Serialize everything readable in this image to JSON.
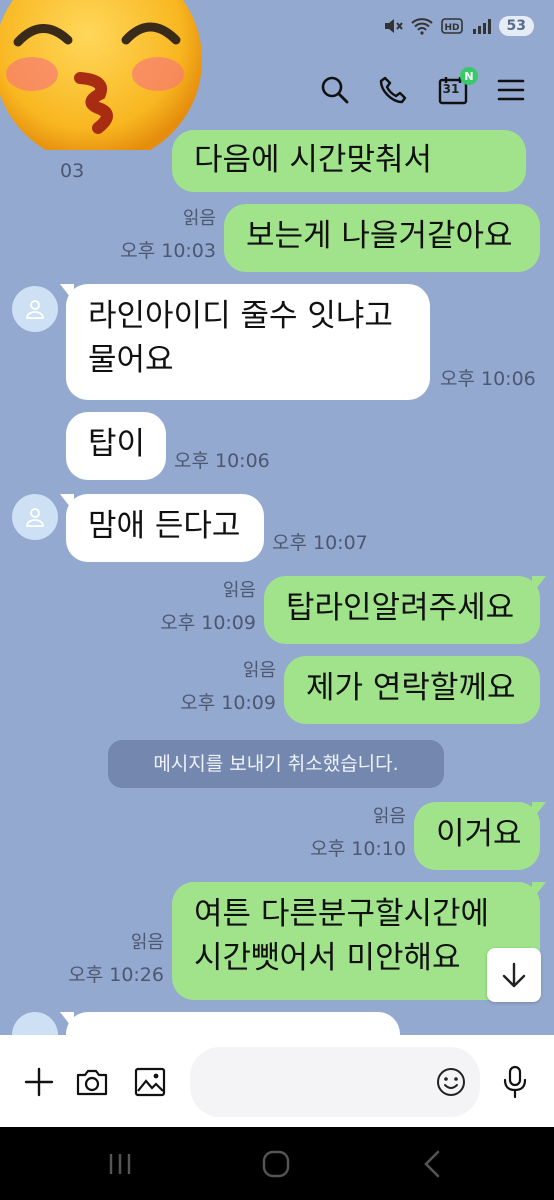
{
  "status_bar": {
    "battery": "53"
  },
  "top_bar": {
    "calendar_day": "31",
    "calendar_badge": "N"
  },
  "messages": [
    {
      "text": "다음에 시간맞춰서",
      "time": "03"
    },
    {
      "read": "읽음",
      "time": "오후 10:03",
      "text": "보는게 나을거같아요"
    },
    {
      "line1": "라인아이디 줄수 잇냐고",
      "line2": "물어요",
      "time": "오후 10:06"
    },
    {
      "text": "탑이",
      "time": "오후 10:06"
    },
    {
      "text": "맘애 든다고",
      "time": "오후 10:07"
    },
    {
      "read": "읽음",
      "time": "오후 10:09",
      "text": "탑라인알려주세요"
    },
    {
      "read": "읽음",
      "time": "오후 10:09",
      "text": "제가 연락할께요"
    },
    {
      "read": "읽음",
      "time": "오후 10:10",
      "text": "이거요"
    },
    {
      "read": "읽음",
      "time": "오후 10:26",
      "line1": "여튼 다른분구할시간에",
      "line2": "시간뺏어서 미안해요"
    }
  ],
  "system_message": "메시지를 보내기 취소했습니다.",
  "input": {
    "placeholder": ""
  },
  "colors": {
    "background": "#94a9cf",
    "my_bubble": "#a1e38a",
    "their_bubble": "#ffffff",
    "badge": "#37c96a"
  },
  "icons": [
    "mute-icon",
    "wifi-icon",
    "hd-icon",
    "signal-icon",
    "search-icon",
    "phone-icon",
    "calendar-icon",
    "menu-icon",
    "person-icon",
    "chevron-down-icon",
    "plus-icon",
    "camera-icon",
    "image-icon",
    "emoji-icon",
    "microphone-icon",
    "recents-icon",
    "home-icon",
    "back-icon"
  ]
}
